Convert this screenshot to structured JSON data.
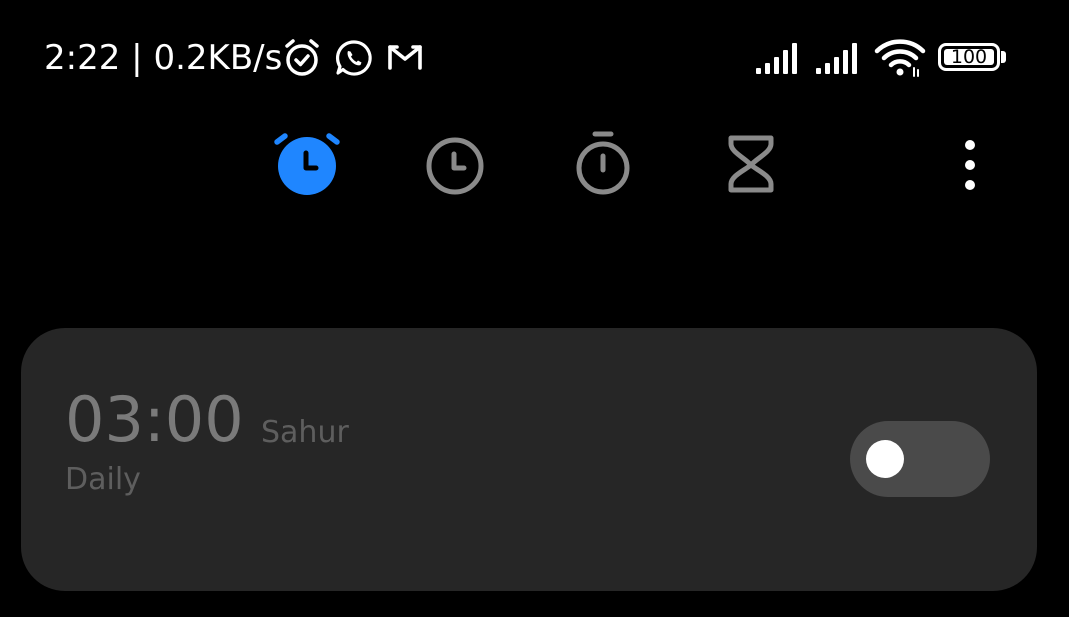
{
  "status_bar": {
    "time": "2:22",
    "separator": "|",
    "network_speed": "0.2KB/s",
    "icons": [
      "alarm-icon",
      "whatsapp-icon",
      "gmail-icon",
      "signal-icon",
      "signal-icon",
      "wifi-icon",
      "battery-icon"
    ],
    "battery_level": "100"
  },
  "tabs": [
    {
      "name": "alarm",
      "icon": "alarm-icon",
      "active": true
    },
    {
      "name": "clock",
      "icon": "clock-icon",
      "active": false
    },
    {
      "name": "stopwatch",
      "icon": "stopwatch-icon",
      "active": false
    },
    {
      "name": "timer",
      "icon": "hourglass-icon",
      "active": false
    }
  ],
  "colors": {
    "accent": "#1f86ff",
    "background": "#000000",
    "card": "#262626",
    "icon_inactive": "#8a8a8a",
    "time_text": "#7a7a7a",
    "secondary_text": "#5e5e5e",
    "toggle_off": "#4a4a4a"
  },
  "alarms": [
    {
      "time": "03:00",
      "label": "Sahur",
      "repeat": "Daily",
      "enabled": false
    }
  ]
}
